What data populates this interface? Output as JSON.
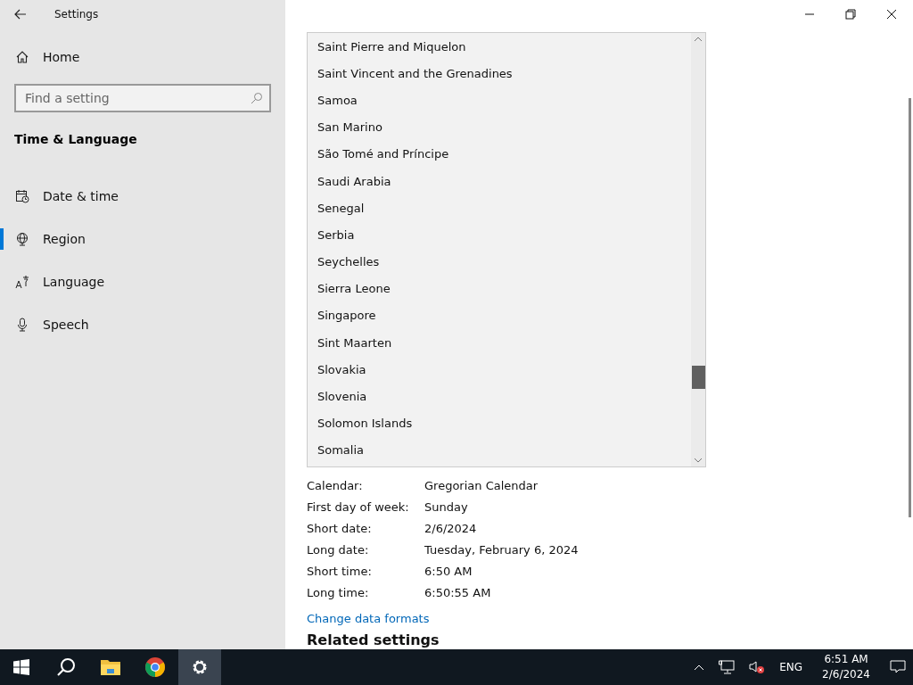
{
  "window": {
    "title": "Settings"
  },
  "sidebar": {
    "home": "Home",
    "search": {
      "placeholder": "Find a setting"
    },
    "section": "Time & Language",
    "items": [
      {
        "label": "Date & time",
        "kind": "calendar",
        "selected": false
      },
      {
        "label": "Region",
        "kind": "globe",
        "selected": true
      },
      {
        "label": "Language",
        "kind": "language",
        "selected": false
      },
      {
        "label": "Speech",
        "kind": "microphone",
        "selected": false
      }
    ]
  },
  "region_list": {
    "items": [
      "Saint Pierre and Miquelon",
      "Saint Vincent and the Grenadines",
      "Samoa",
      "San Marino",
      "São Tomé and Príncipe",
      "Saudi Arabia",
      "Senegal",
      "Serbia",
      "Seychelles",
      "Sierra Leone",
      "Singapore",
      "Sint Maarten",
      "Slovakia",
      "Slovenia",
      "Solomon Islands",
      "Somalia"
    ],
    "scroll": {
      "level": 0.78
    }
  },
  "formats": [
    {
      "label": "Calendar:",
      "value": "Gregorian Calendar"
    },
    {
      "label": "First day of week:",
      "value": "Sunday"
    },
    {
      "label": "Short date:",
      "value": "2/6/2024"
    },
    {
      "label": "Long date:",
      "value": "Tuesday, February 6, 2024"
    },
    {
      "label": "Short time:",
      "value": "6:50 AM"
    },
    {
      "label": "Long time:",
      "value": "6:50:55 AM"
    }
  ],
  "change_link": "Change data formats",
  "related_heading": "Related settings",
  "taskbar": {
    "apps": [
      {
        "kind": "start",
        "active": false
      },
      {
        "kind": "search",
        "active": false
      },
      {
        "kind": "folder",
        "active": false
      },
      {
        "kind": "browser",
        "active": false
      },
      {
        "kind": "gear",
        "active": true
      }
    ],
    "language": "ENG",
    "time": "6:51 AM",
    "date": "2/6/2024"
  }
}
